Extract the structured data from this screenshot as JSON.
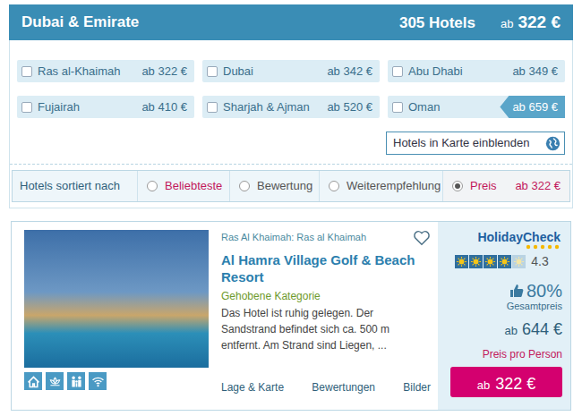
{
  "header": {
    "title": "Dubai & Emirate",
    "count": "305 Hotels",
    "price_prefix": "ab",
    "price": "322 €"
  },
  "regions": [
    {
      "label": "Ras al-Khaimah",
      "price": "ab 322 €",
      "checked": false,
      "highlighted": false
    },
    {
      "label": "Dubai",
      "price": "ab 342 €",
      "checked": false,
      "highlighted": false
    },
    {
      "label": "Abu Dhabi",
      "price": "ab 349 €",
      "checked": false,
      "highlighted": false
    },
    {
      "label": "Fujairah",
      "price": "ab 410 €",
      "checked": false,
      "highlighted": false
    },
    {
      "label": "Sharjah & Ajman",
      "price": "ab 520 €",
      "checked": false,
      "highlighted": false
    },
    {
      "label": "Oman",
      "price": "ab 659 €",
      "checked": false,
      "highlighted": true
    }
  ],
  "map_button": {
    "label": "Hotels in Karte einblenden"
  },
  "sort": {
    "label": "Hotels sortiert nach",
    "options": [
      {
        "label": "Beliebteste",
        "selected": false,
        "color": "#c2185b"
      },
      {
        "label": "Bewertung",
        "selected": false,
        "color": "#555555"
      },
      {
        "label": "Weiterempfehlung",
        "selected": false,
        "color": "#555555"
      },
      {
        "label": "Preis",
        "selected": true,
        "color": "#c2185b",
        "price": "ab 322 €"
      }
    ]
  },
  "hotel": {
    "location": "Ras Al Khaimah: Ras al Khaimah",
    "favorite": false,
    "name": "Al Hamra Village Golf & Beach Resort",
    "category": "Gehobene Kategorie",
    "description": "Das Hotel ist ruhig gelegen. Der Sandstrand befindet sich ca. 500 m entfernt. Am Strand sind Liegen, ...",
    "links": [
      "Lage & Karte",
      "Bewertungen",
      "Bilder"
    ],
    "rating": {
      "brand": "HolidayCheck",
      "stars": 4,
      "score": "4.3",
      "recommendation": "80%",
      "recommendation_label": "Gesamtpreis"
    },
    "total_price_prefix": "ab",
    "total_price": "644 €",
    "per_person_label": "Preis pro Person",
    "button_prefix": "ab",
    "button_price": "322 €"
  }
}
